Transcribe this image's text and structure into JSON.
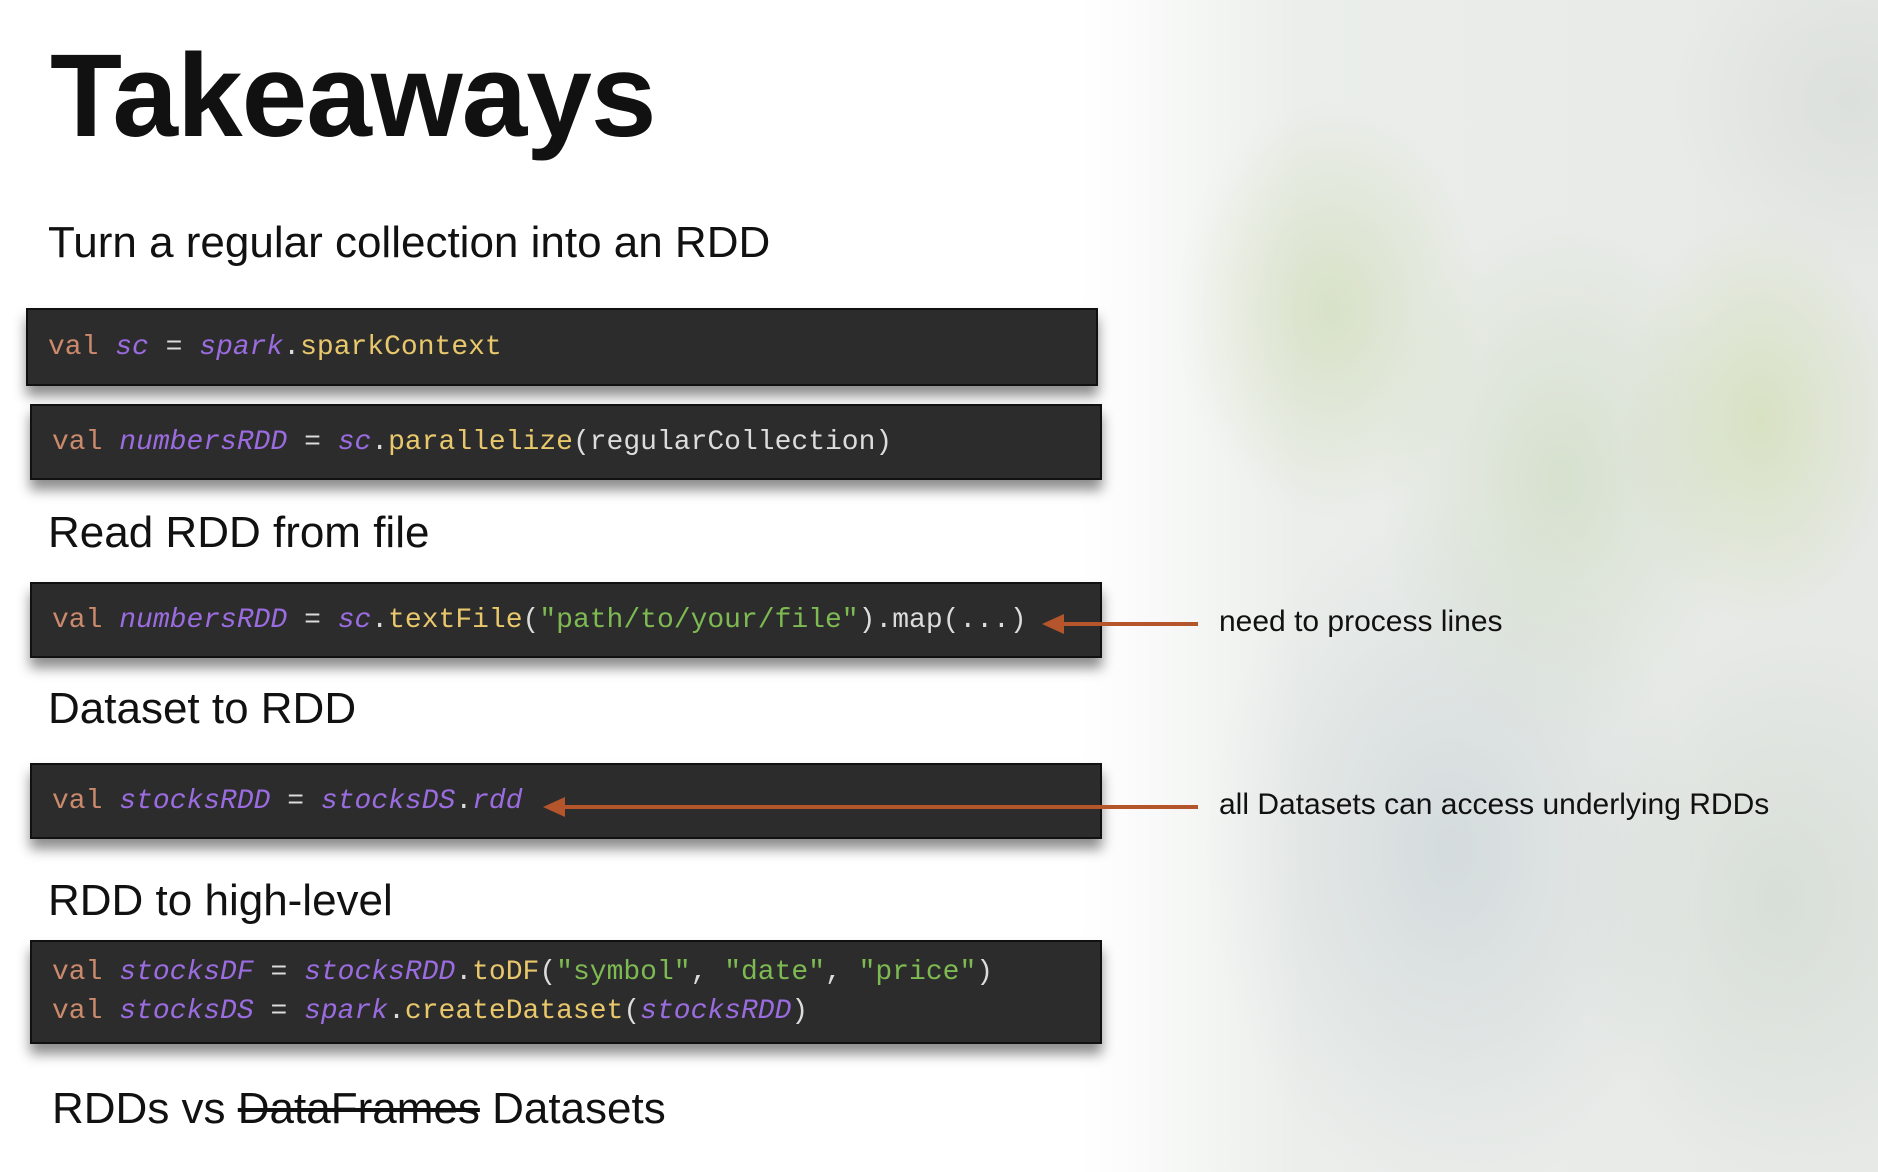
{
  "title": "Takeaways",
  "sections": [
    {
      "heading": "Turn a regular collection into an RDD"
    },
    {
      "heading": "Read RDD from file"
    },
    {
      "heading": "Dataset to RDD"
    },
    {
      "heading": "RDD to high-level"
    }
  ],
  "code": {
    "c1": [
      "val",
      " ",
      "sc",
      " = ",
      "spark",
      ".",
      "sparkContext"
    ],
    "c2": [
      "val",
      " ",
      "numbersRDD",
      " = ",
      "sc",
      ".",
      "parallelize",
      "(regularCollection)"
    ],
    "c3": [
      "val",
      " ",
      "numbersRDD",
      " = ",
      "sc",
      ".",
      "textFile",
      "(",
      "\"path/to/your/file\"",
      ").map(...)"
    ],
    "c4": [
      "val",
      " ",
      "stocksRDD",
      " = ",
      "stocksDS",
      ".",
      "rdd"
    ],
    "c5a": [
      "val",
      " ",
      "stocksDF",
      " = ",
      "stocksRDD",
      ".",
      "toDF",
      "(",
      "\"symbol\"",
      ", ",
      "\"date\"",
      ", ",
      "\"price\"",
      ")"
    ],
    "c5b": [
      "val",
      " ",
      "stocksDS",
      " = ",
      "spark",
      ".",
      "createDataset",
      "(",
      "stocksRDD",
      ")"
    ]
  },
  "notes": {
    "n1": "need to process lines",
    "n2": "all Datasets can access underlying RDDs"
  },
  "footer": {
    "a": "RDDs vs ",
    "struck": "DataFrames",
    "b": " Datasets"
  }
}
